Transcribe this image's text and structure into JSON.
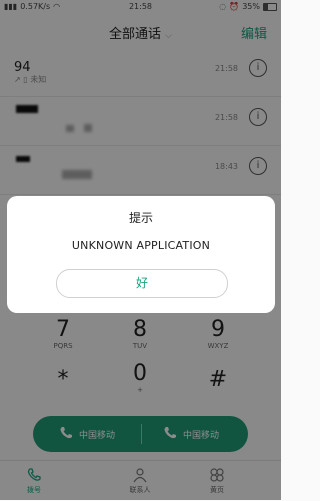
{
  "status_bar": {
    "left": "0.57K/s",
    "time": "21:58",
    "battery": "35%"
  },
  "header": {
    "title": "全部通话",
    "edit": "编辑"
  },
  "calls": [
    {
      "name": "94",
      "sub": "未知",
      "time": "21:58"
    },
    {
      "name": "",
      "sub": "",
      "time": "21:58"
    },
    {
      "name": "",
      "sub": "",
      "time": "18:43"
    }
  ],
  "dialpad": {
    "keys": [
      {
        "digit": "7",
        "letters": "PQRS"
      },
      {
        "digit": "8",
        "letters": "TUV"
      },
      {
        "digit": "9",
        "letters": "WXYZ"
      },
      {
        "digit": "*",
        "letters": ""
      },
      {
        "digit": "0",
        "letters": "+"
      },
      {
        "digit": "#",
        "letters": ""
      }
    ]
  },
  "call_buttons": {
    "sim1": "中国移动",
    "sim2": "中国移动"
  },
  "bottom_nav": {
    "items": [
      "拨号",
      "联系人",
      "黄页"
    ]
  },
  "dialog": {
    "title": "提示",
    "message": "UNKNOWN APPLICATION",
    "ok": "好"
  },
  "colors": {
    "accent": "#1aa37e",
    "call_bar": "#1f9b76"
  }
}
